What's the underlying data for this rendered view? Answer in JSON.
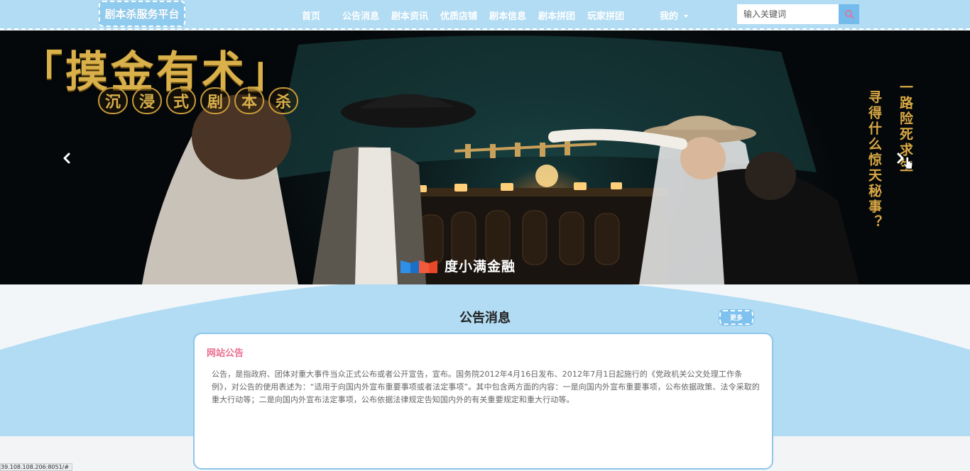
{
  "header": {
    "logo": "剧本杀服务平台",
    "nav": [
      {
        "label": "首页"
      },
      {
        "label": "公告消息"
      },
      {
        "label": "剧本资讯"
      },
      {
        "label": "优质店铺"
      },
      {
        "label": "剧本信息"
      },
      {
        "label": "剧本拼团"
      },
      {
        "label": "玩家拼团"
      }
    ],
    "mine_label": "我的",
    "search_placeholder": "输入关键词"
  },
  "banner": {
    "title": "「摸金有术」",
    "subtitle_chars": [
      "沉",
      "浸",
      "式",
      "剧",
      "本",
      "杀"
    ],
    "vertical_right": "一路险死求生",
    "vertical_left": "寻得什么惊天秘事？",
    "brand": "度小满金融"
  },
  "notice": {
    "section_title": "公告消息",
    "more_label": "更多",
    "card_heading": "网站公告",
    "card_body": "公告，是指政府、团体对重大事件当众正式公布或者公开宣告，宣布。国务院2012年4月16日发布、2012年7月1日起施行的《党政机关公文处理工作条例》，对公告的使用表述为：“适用于向国内外宣布重要事项或者法定事项”。其中包含两方面的内容：一是向国内外宣布重要事项，公布依据政策、法令采取的重大行动等；二是向国内外宣布法定事项，公布依据法律规定告知国内外的有关重要规定和重大行动等。"
  },
  "status_bar": {
    "url": "39.108.108.206:8051/#"
  },
  "colors": {
    "header_bg": "#b1dcf3",
    "accent": "#74bbed",
    "heading_pink": "#ea6e8f",
    "section_wave": "#b1dcf3"
  }
}
